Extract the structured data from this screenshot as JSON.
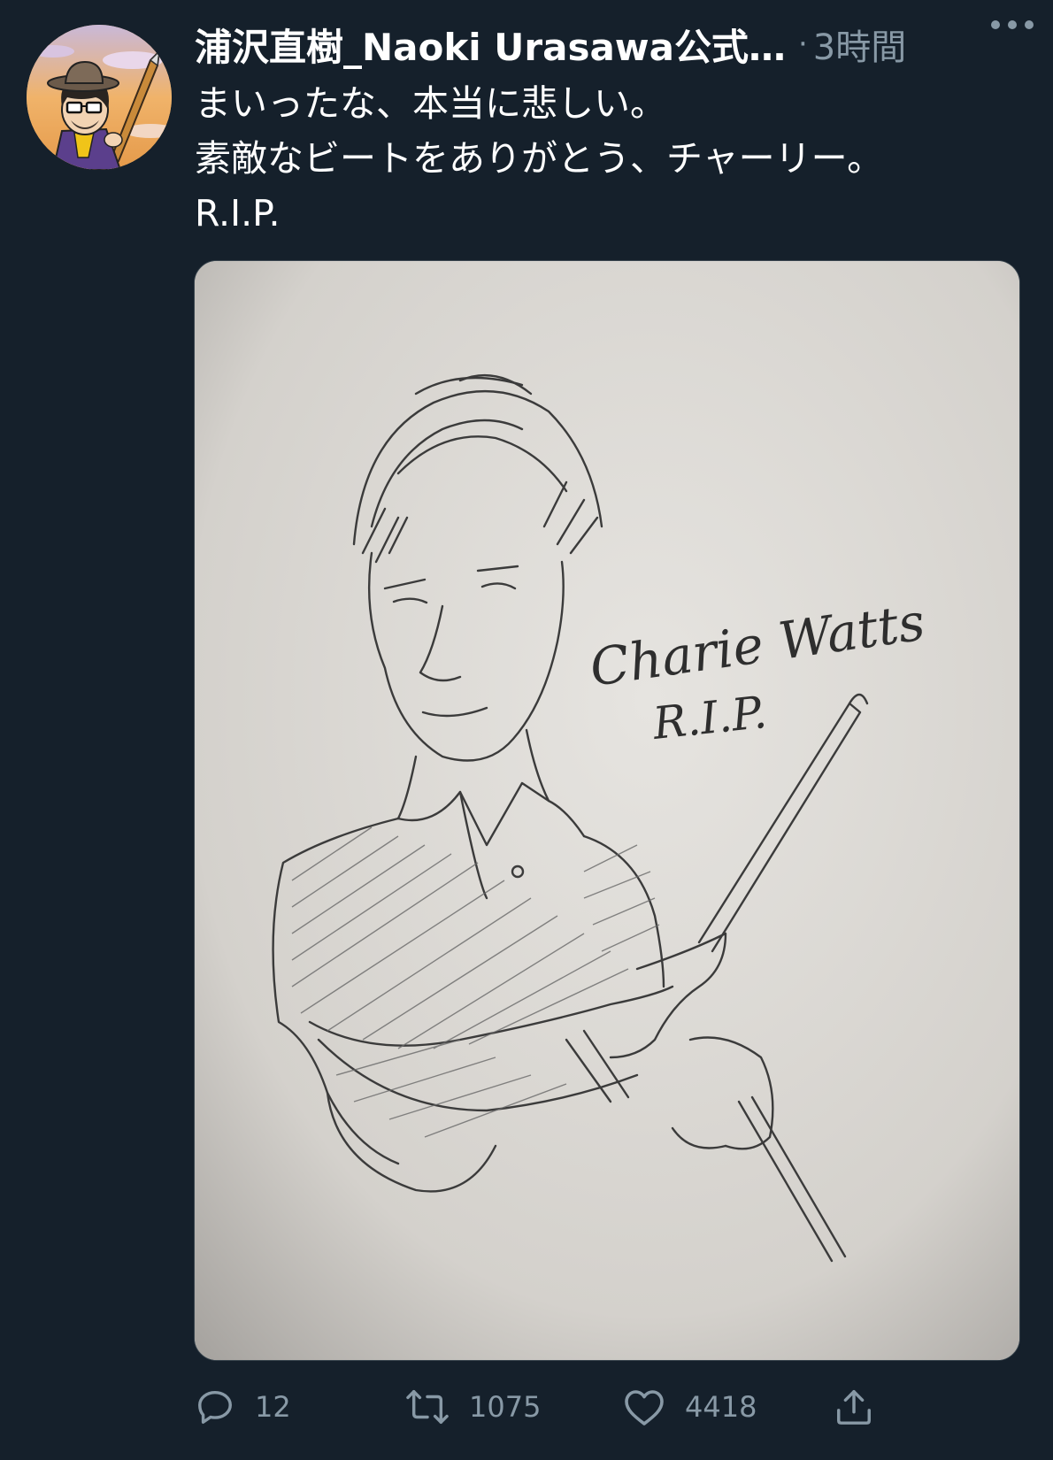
{
  "tweet": {
    "display_name": "浦沢直樹_Naoki Urasawa公式…",
    "separator": "·",
    "timestamp": "3時間",
    "text_lines": [
      "まいったな、本当に悲しい。",
      "素敵なビートをありがとう、チャーリー。",
      "R.I.P."
    ],
    "image_text": {
      "line1": "Charie Watts",
      "line2": "R.I.P."
    }
  },
  "actions": {
    "reply_count": "12",
    "retweet_count": "1075",
    "like_count": "4418"
  },
  "colors": {
    "background": "#15202b",
    "secondary_text": "#8899a6",
    "primary_text": "#ffffff"
  },
  "icons": {
    "reply": "reply-icon",
    "retweet": "retweet-icon",
    "like": "heart-icon",
    "share": "share-icon",
    "more": "more-icon"
  }
}
